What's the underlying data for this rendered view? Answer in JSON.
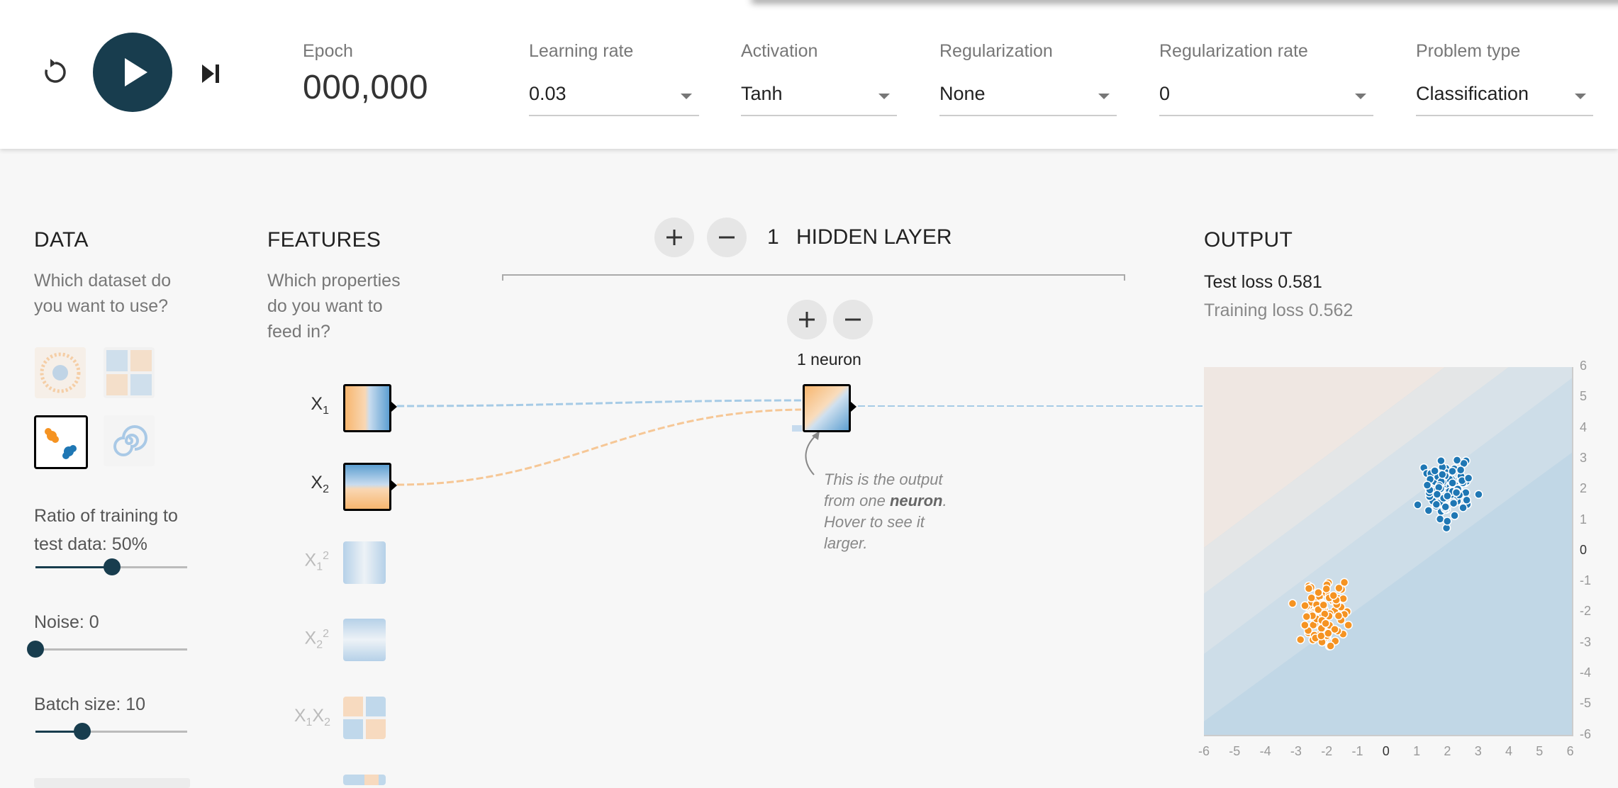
{
  "header": {
    "epoch_label": "Epoch",
    "epoch_value": "000,000",
    "learning_rate": {
      "label": "Learning rate",
      "value": "0.03"
    },
    "activation": {
      "label": "Activation",
      "value": "Tanh"
    },
    "regularization": {
      "label": "Regularization",
      "value": "None"
    },
    "regularization_rate": {
      "label": "Regularization rate",
      "value": "0"
    },
    "problem_type": {
      "label": "Problem type",
      "value": "Classification"
    },
    "icons": {
      "reset": "reset-icon",
      "play": "play-icon",
      "step": "step-icon"
    }
  },
  "data": {
    "title": "DATA",
    "desc_line1": "Which dataset do",
    "desc_line2": "you want to use?",
    "ratio_line1": "Ratio of training to",
    "ratio_line2": "test data:  50%",
    "ratio_value": 0.5,
    "noise_label": "Noise:  0",
    "noise_value": 0,
    "batch_label": "Batch size:  10",
    "batch_value": 0.33
  },
  "features": {
    "title": "FEATURES",
    "desc_line1": "Which properties",
    "desc_line2": "do you want to",
    "desc_line3": "feed in?",
    "items": [
      {
        "base": "X",
        "sub": "1",
        "sup": ""
      },
      {
        "base": "X",
        "sub": "2",
        "sup": ""
      },
      {
        "base": "X",
        "sub": "1",
        "sup": "2"
      },
      {
        "base": "X",
        "sub": "2",
        "sup": "2"
      },
      {
        "base": "X",
        "sub": "1",
        "base2": "X",
        "sub2": "2"
      }
    ]
  },
  "network": {
    "layer_count": "1",
    "layer_label": "HIDDEN LAYER",
    "neuron_label": "1 neuron",
    "add_symbol": "+",
    "remove_symbol": "−",
    "annotation_line1": "This is the output",
    "annotation_line2_pre": "from one ",
    "annotation_bold": "neuron",
    "annotation_line2_post": ".",
    "annotation_line3": "Hover to see it",
    "annotation_line4": "larger."
  },
  "output": {
    "title": "OUTPUT",
    "test_loss": "Test loss 0.581",
    "training_loss": "Training loss 0.562",
    "x_ticks": [
      "-6",
      "-5",
      "-4",
      "-3",
      "-2",
      "-1",
      "0",
      "1",
      "2",
      "3",
      "4",
      "5",
      "6"
    ],
    "y_ticks": [
      "6",
      "5",
      "4",
      "3",
      "2",
      "1",
      "0",
      "-1",
      "-2",
      "-3",
      "-4",
      "-5",
      "-6"
    ],
    "colors": {
      "positive": "#1f77b4",
      "negative": "#f59322"
    }
  }
}
